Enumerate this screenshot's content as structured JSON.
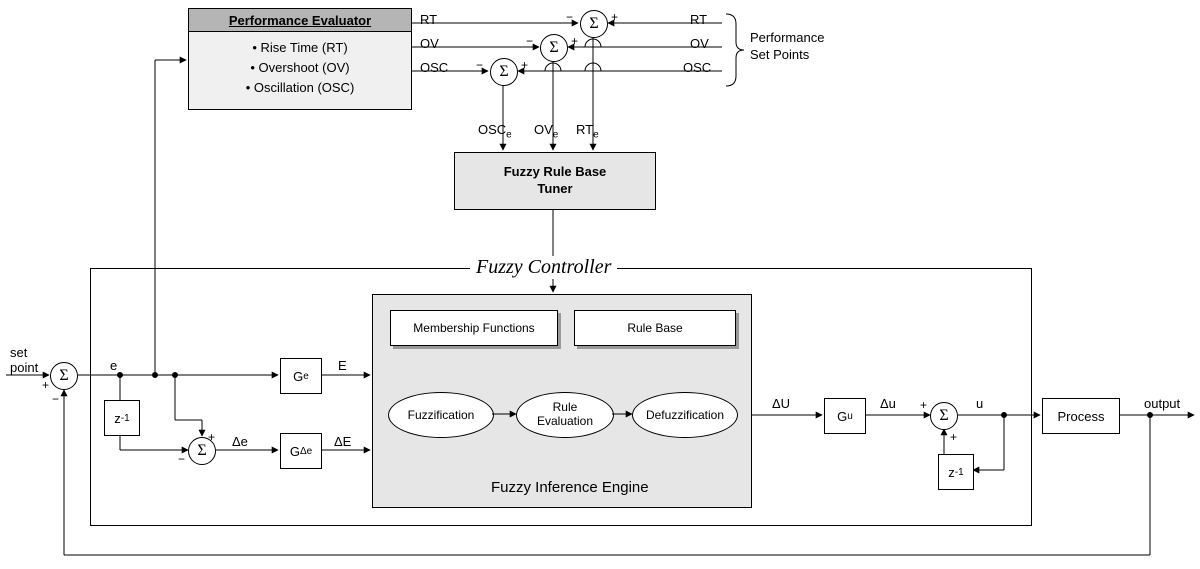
{
  "setpoint_label": "set\npoint",
  "output_label": "output",
  "signals": {
    "e": "e",
    "E": "E",
    "de": "ΔE",
    "de_small": "Δe",
    "dU": "ΔU",
    "du": "Δu",
    "u": "u",
    "RT": "RT",
    "OV": "OV",
    "OSC": "OSC",
    "RT_e": "RT",
    "OV_e": "OV",
    "OSC_e": "OSC"
  },
  "gains": {
    "Ge": "G",
    "Gde": "G",
    "Gu": "G"
  },
  "gain_sub": {
    "Ge": "e",
    "Gde": "Δe",
    "Gu": "u"
  },
  "z1": "z",
  "z1_sup": "-1",
  "perf_eval": {
    "title": "Performance Evaluator",
    "items": [
      "• Rise Time (RT)",
      "• Overshoot (OV)",
      "• Oscillation (OSC)"
    ]
  },
  "perf_set_points": "Performance\nSet Points",
  "tuner": "Fuzzy Rule Base\nTuner",
  "controller_title": "Fuzzy  Controller",
  "engine_title": "Fuzzy Inference Engine",
  "mf": "Membership Functions",
  "rb": "Rule Base",
  "steps": {
    "fuz": "Fuzzification",
    "eval": "Rule\nEvaluation",
    "defuz": "Defuzzification"
  },
  "process": "Process",
  "sigma": "Σ",
  "plus": "+",
  "minus": "−"
}
